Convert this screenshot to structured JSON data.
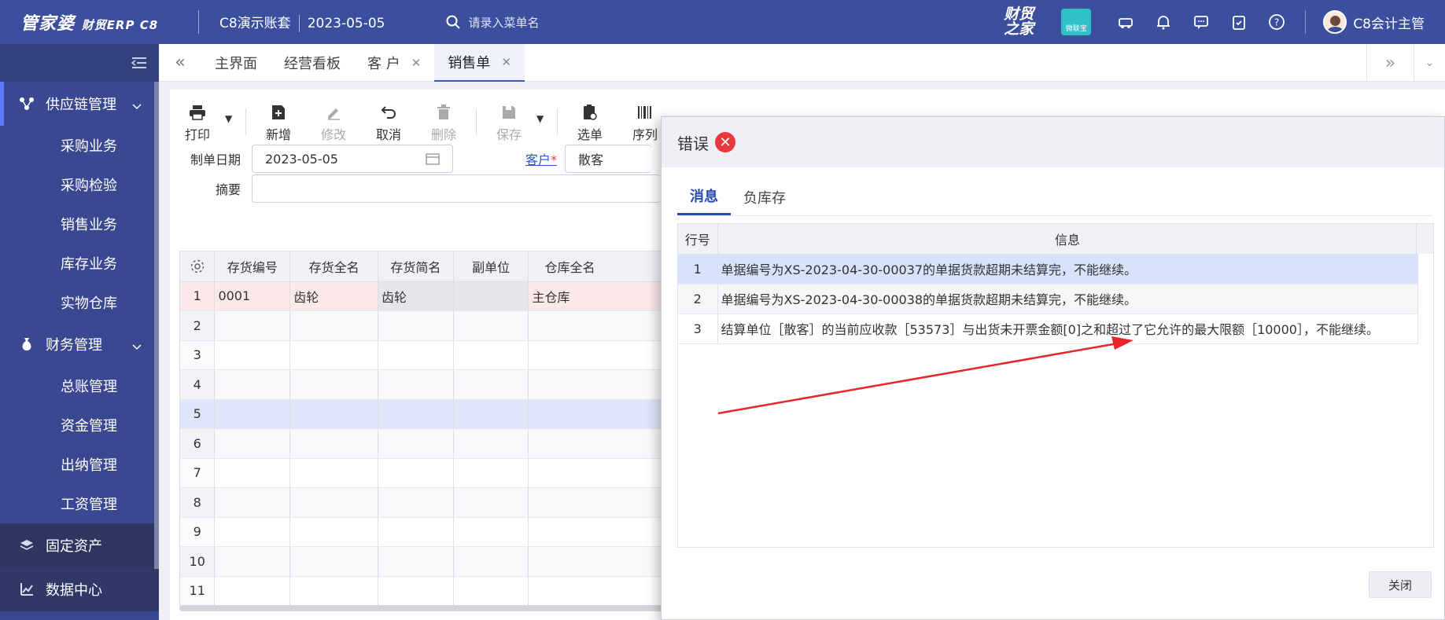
{
  "app": {
    "logo": "管家婆",
    "logo_sub": "财贸ERP C8",
    "account": "C8演示账套",
    "date": "2023-05-05",
    "search_placeholder": "请录入菜单名",
    "brand_badge": "财贸之家",
    "qr_label": "微联宝",
    "user": "C8会计主管"
  },
  "sidebar": {
    "groups": [
      {
        "label": "供应链管理",
        "items": [
          "采购业务",
          "采购检验",
          "销售业务",
          "库存业务",
          "实物仓库"
        ]
      },
      {
        "label": "财务管理",
        "items": [
          "总账管理",
          "资金管理",
          "出纳管理",
          "工资管理"
        ]
      },
      {
        "label": "固定资产"
      },
      {
        "label": "数据中心"
      }
    ]
  },
  "tabs": [
    {
      "label": "主界面"
    },
    {
      "label": "经营看板"
    },
    {
      "label": "客 户"
    },
    {
      "label": "销售单"
    }
  ],
  "toolbar": {
    "print": "打印",
    "new": "新增",
    "edit": "修改",
    "cancel": "取消",
    "delete": "删除",
    "save": "保存",
    "select": "选单",
    "serial": "序列"
  },
  "form": {
    "date_label": "制单日期",
    "date_value": "2023-05-05",
    "customer_label": "客户",
    "customer_required": "*",
    "customer_value": "散客",
    "summary_label": "摘要",
    "summary_value": ""
  },
  "grid": {
    "columns": [
      "存货编号",
      "存货全名",
      "存货简名",
      "副单位",
      "仓库全名"
    ],
    "rows": [
      {
        "no": "1",
        "cells": [
          "0001",
          "齿轮",
          "齿轮",
          "",
          "主仓库"
        ]
      },
      {
        "no": "2",
        "cells": [
          "",
          "",
          "",
          "",
          ""
        ]
      },
      {
        "no": "3",
        "cells": [
          "",
          "",
          "",
          "",
          ""
        ]
      },
      {
        "no": "4",
        "cells": [
          "",
          "",
          "",
          "",
          ""
        ]
      },
      {
        "no": "5",
        "cells": [
          "",
          "",
          "",
          "",
          ""
        ]
      },
      {
        "no": "6",
        "cells": [
          "",
          "",
          "",
          "",
          ""
        ]
      },
      {
        "no": "7",
        "cells": [
          "",
          "",
          "",
          "",
          ""
        ]
      },
      {
        "no": "8",
        "cells": [
          "",
          "",
          "",
          "",
          ""
        ]
      },
      {
        "no": "9",
        "cells": [
          "",
          "",
          "",
          "",
          ""
        ]
      },
      {
        "no": "10",
        "cells": [
          "",
          "",
          "",
          "",
          ""
        ]
      },
      {
        "no": "11",
        "cells": [
          "",
          "",
          "",
          "",
          ""
        ]
      }
    ]
  },
  "dialog": {
    "title": "错误",
    "tabs": [
      "消息",
      "负库存"
    ],
    "columns": [
      "行号",
      "信息"
    ],
    "rows": [
      {
        "no": "1",
        "msg": "单据编号为XS-2023-04-30-00037的单据货款超期未结算完，不能继续。"
      },
      {
        "no": "2",
        "msg": "单据编号为XS-2023-04-30-00038的单据货款超期未结算完，不能继续。"
      },
      {
        "no": "3",
        "msg": "结算单位［散客］的当前应收款［53573］与出货未开票金额[0]之和超过了它允许的最大限额［10000］，不能继续。"
      }
    ],
    "close": "关闭"
  },
  "colors": {
    "topbar": "#3c4f9e",
    "sidebar": "#3a4891",
    "accent": "#2a4bb0",
    "error": "#e8383d",
    "annotation_arrow": "#e8262b"
  }
}
